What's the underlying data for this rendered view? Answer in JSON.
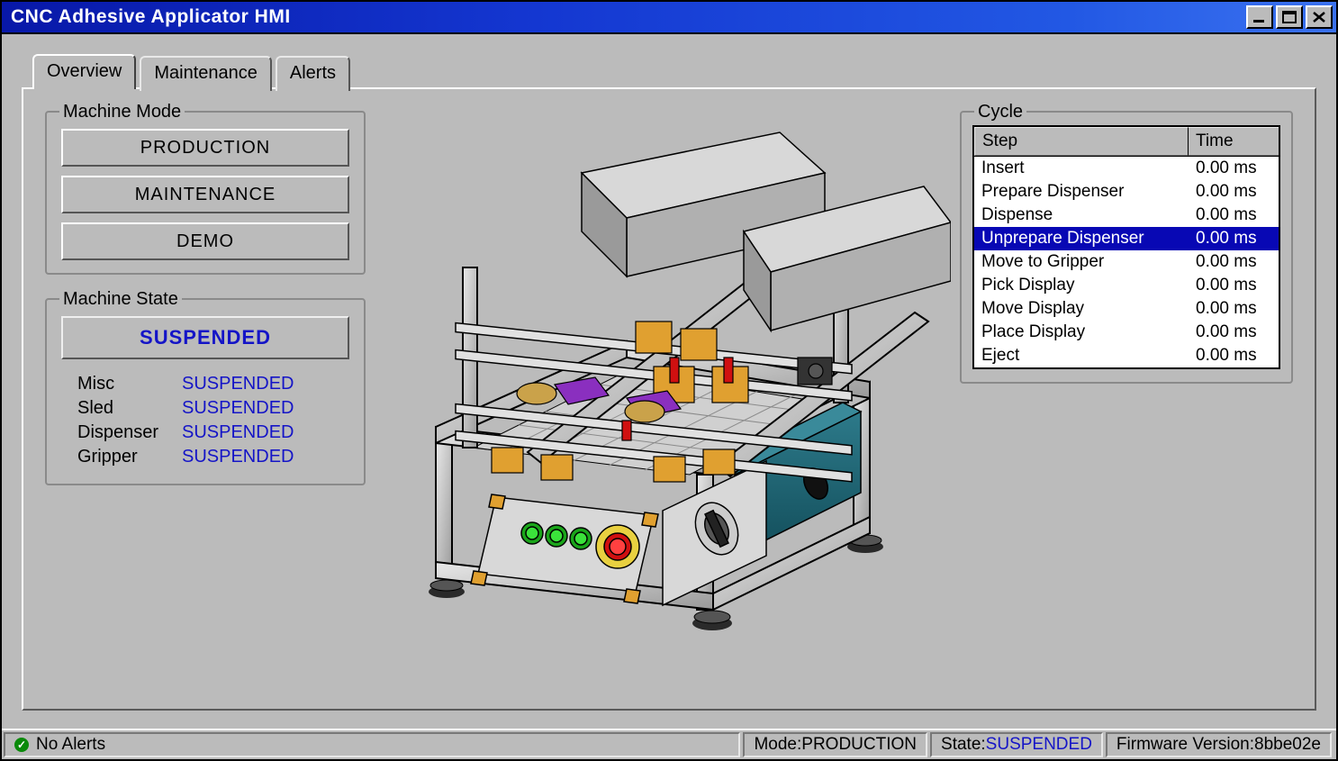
{
  "window": {
    "title": "CNC Adhesive Applicator HMI"
  },
  "tabs": {
    "0": {
      "label": "Overview"
    },
    "1": {
      "label": "Maintenance"
    },
    "2": {
      "label": "Alerts"
    }
  },
  "mode": {
    "legend": "Machine Mode",
    "buttons": {
      "0": "PRODUCTION",
      "1": "MAINTENANCE",
      "2": "DEMO"
    }
  },
  "state": {
    "legend": "Machine State",
    "main": "SUSPENDED",
    "rows": {
      "0": {
        "label": "Misc",
        "value": "SUSPENDED"
      },
      "1": {
        "label": "Sled",
        "value": "SUSPENDED"
      },
      "2": {
        "label": "Dispenser",
        "value": "SUSPENDED"
      },
      "3": {
        "label": "Gripper",
        "value": "SUSPENDED"
      }
    }
  },
  "cycle": {
    "legend": "Cycle",
    "head": {
      "step": "Step",
      "time": "Time"
    },
    "rows": {
      "0": {
        "step": "Insert",
        "time": "0.00 ms"
      },
      "1": {
        "step": "Prepare Dispenser",
        "time": "0.00 ms"
      },
      "2": {
        "step": "Dispense",
        "time": "0.00 ms"
      },
      "3": {
        "step": "Unprepare Dispenser",
        "time": "0.00 ms"
      },
      "4": {
        "step": "Move to Gripper",
        "time": "0.00 ms"
      },
      "5": {
        "step": "Pick Display",
        "time": "0.00 ms"
      },
      "6": {
        "step": "Move Display",
        "time": "0.00 ms"
      },
      "7": {
        "step": "Place Display",
        "time": "0.00 ms"
      },
      "8": {
        "step": "Eject",
        "time": "0.00 ms"
      }
    },
    "selected_index": 3
  },
  "statusbar": {
    "alerts": "No Alerts",
    "mode_label": "Mode: ",
    "mode_value": "PRODUCTION",
    "state_label": "State: ",
    "state_value": "SUSPENDED",
    "fw_label": "Firmware Version: ",
    "fw_value": "8bbe02e"
  }
}
